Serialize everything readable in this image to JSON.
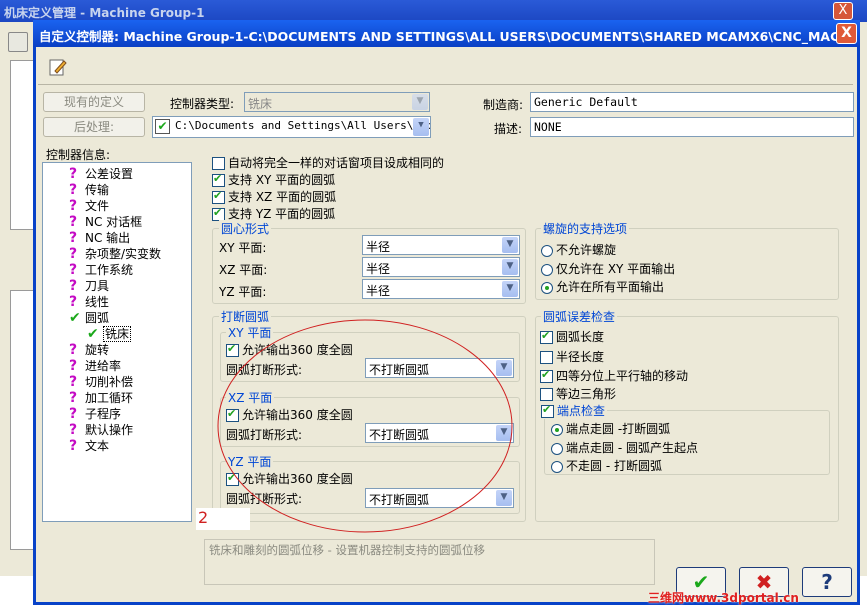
{
  "bg_window": {
    "title": "机床定义管理 - Machine Group-1",
    "close": "X"
  },
  "dialog": {
    "title": "自定义控制器: Machine Group-1-C:\\DOCUMENTS AND SETTINGS\\ALL USERS\\DOCUMENTS\\SHARED MCAMX6\\CNC_MAC...",
    "close": "X"
  },
  "buttons": {
    "existing": "现有的定义",
    "post": "后处理:"
  },
  "controller_type": {
    "label": "控制器类型:",
    "value": "铣床"
  },
  "post_path": "C:\\Documents and Settings\\All Users\\Docu",
  "manufacturer": {
    "label": "制造商:",
    "value": "Generic Default"
  },
  "description": {
    "label": "描述:",
    "value": "NONE"
  },
  "tree_label": "控制器信息:",
  "tree": [
    {
      "icon": "?",
      "label": "公差设置"
    },
    {
      "icon": "?",
      "label": "传输"
    },
    {
      "icon": "?",
      "label": "文件"
    },
    {
      "icon": "?",
      "label": "NC 对话框"
    },
    {
      "icon": "?",
      "label": "NC 输出"
    },
    {
      "icon": "?",
      "label": "杂项整/实变数"
    },
    {
      "icon": "?",
      "label": "工作系统"
    },
    {
      "icon": "?",
      "label": "刀具"
    },
    {
      "icon": "?",
      "label": "线性"
    },
    {
      "icon": "✔",
      "label": "圆弧"
    },
    {
      "icon": "✔",
      "label": "铣床"
    },
    {
      "icon": "?",
      "label": "旋转"
    },
    {
      "icon": "?",
      "label": "进给率"
    },
    {
      "icon": "?",
      "label": "切削补偿"
    },
    {
      "icon": "?",
      "label": "加工循环"
    },
    {
      "icon": "?",
      "label": "子程序"
    },
    {
      "icon": "?",
      "label": "默认操作"
    },
    {
      "icon": "?",
      "label": "文本"
    }
  ],
  "top_checks": [
    {
      "label": "自动将完全一样的对话窗项目设成相同的",
      "checked": false
    },
    {
      "label": "支持 XY 平面的圆弧",
      "checked": true
    },
    {
      "label": "支持 XZ 平面的圆弧",
      "checked": true
    },
    {
      "label": "支持 YZ 平面的圆弧",
      "checked": true
    }
  ],
  "center_group": {
    "title": "圆心形式",
    "rows": [
      {
        "label": "XY 平面:",
        "value": "半径"
      },
      {
        "label": "XZ 平面:",
        "value": "半径"
      },
      {
        "label": "YZ 平面:",
        "value": "半径"
      }
    ]
  },
  "break_group": {
    "title": "打断圆弧",
    "planes": [
      {
        "title": "XY 平面",
        "check": "允许输出360 度全圆",
        "form_label": "圆弧打断形式:",
        "form_value": "不打断圆弧"
      },
      {
        "title": "XZ 平面",
        "check": "允许输出360 度全圆",
        "form_label": "圆弧打断形式:",
        "form_value": "不打断圆弧"
      },
      {
        "title": "YZ 平面",
        "check": "允许输出360 度全圆",
        "form_label": "圆弧打断形式:",
        "form_value": "不打断圆弧"
      }
    ]
  },
  "helix_group": {
    "title": "螺旋的支持选项",
    "options": [
      {
        "label": "不允许螺旋",
        "selected": false
      },
      {
        "label": "仅允许在 XY 平面输出",
        "selected": false
      },
      {
        "label": "允许在所有平面输出",
        "selected": true
      }
    ]
  },
  "tol_group": {
    "title": "圆弧误差检查",
    "checks": [
      {
        "label": "圆弧长度",
        "checked": true
      },
      {
        "label": "半径长度",
        "checked": false
      },
      {
        "label": "四等分位上平行轴的移动",
        "checked": true
      },
      {
        "label": "等边三角形",
        "checked": false
      }
    ],
    "endpoint": {
      "label": "端点检查",
      "checked": true,
      "options": [
        {
          "label": "端点走圆 -打断圆弧",
          "selected": true
        },
        {
          "label": "端点走圆 - 圆弧产生起点",
          "selected": false
        },
        {
          "label": "不走圆 - 打断圆弧",
          "selected": false
        }
      ]
    }
  },
  "annotation": "2",
  "status_text": "铣床和雕刻的圆弧位移 - 设置机器控制支持的圆弧位移",
  "watermark": "三维网www.3dportal.cn",
  "colors": {
    "title_blue": "#0a3fc4",
    "group_label": "#0046d5",
    "check_green": "#21a121",
    "annot_red": "#d02020"
  }
}
